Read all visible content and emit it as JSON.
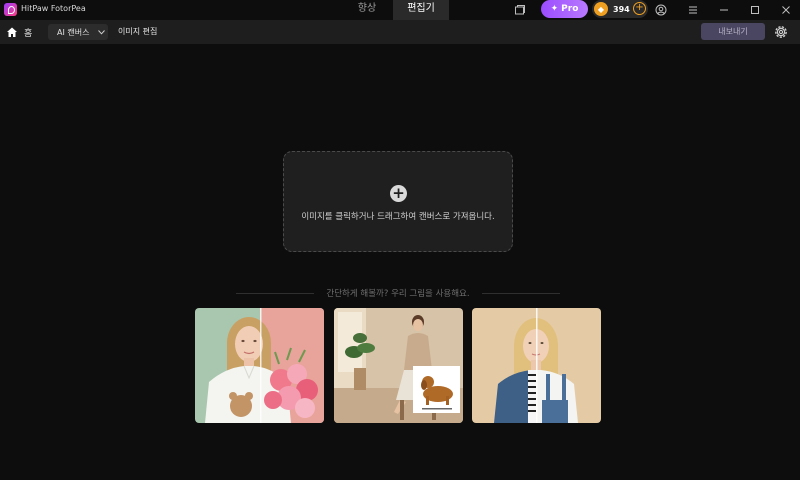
{
  "app": {
    "name": "HitPaw FotorPea"
  },
  "top_tabs": [
    {
      "label": "향상",
      "active": false
    },
    {
      "label": "편집기",
      "active": true
    }
  ],
  "window_icons": [
    "window-icon",
    "user-icon",
    "menu-icon",
    "minimize-icon",
    "maximize-icon",
    "close-icon"
  ],
  "pro": {
    "label": "Pro",
    "icon": "sparkle-icon"
  },
  "coins": {
    "count": "394"
  },
  "toolbar": {
    "home_label": "홈",
    "ai_canvas_label": "AI 캔버스",
    "image_edit_label": "이미지 편집",
    "export_label": "내보내기"
  },
  "dropzone": {
    "text": "이미지를 클릭하거나 드래그하여 캔버스로 가져옵니다."
  },
  "samples": {
    "heading": "간단하게 해볼까? 우리 그림을 사용해요.",
    "items": [
      "portrait-bouquet",
      "woman-chair-dog",
      "woman-denim-split"
    ]
  },
  "colors": {
    "background": "#0d0d0d",
    "toolbar": "#1e1e1e",
    "pro_gradient_start": "#9b4dff",
    "coin": "#f0a020",
    "export_button": "#4a4560"
  }
}
